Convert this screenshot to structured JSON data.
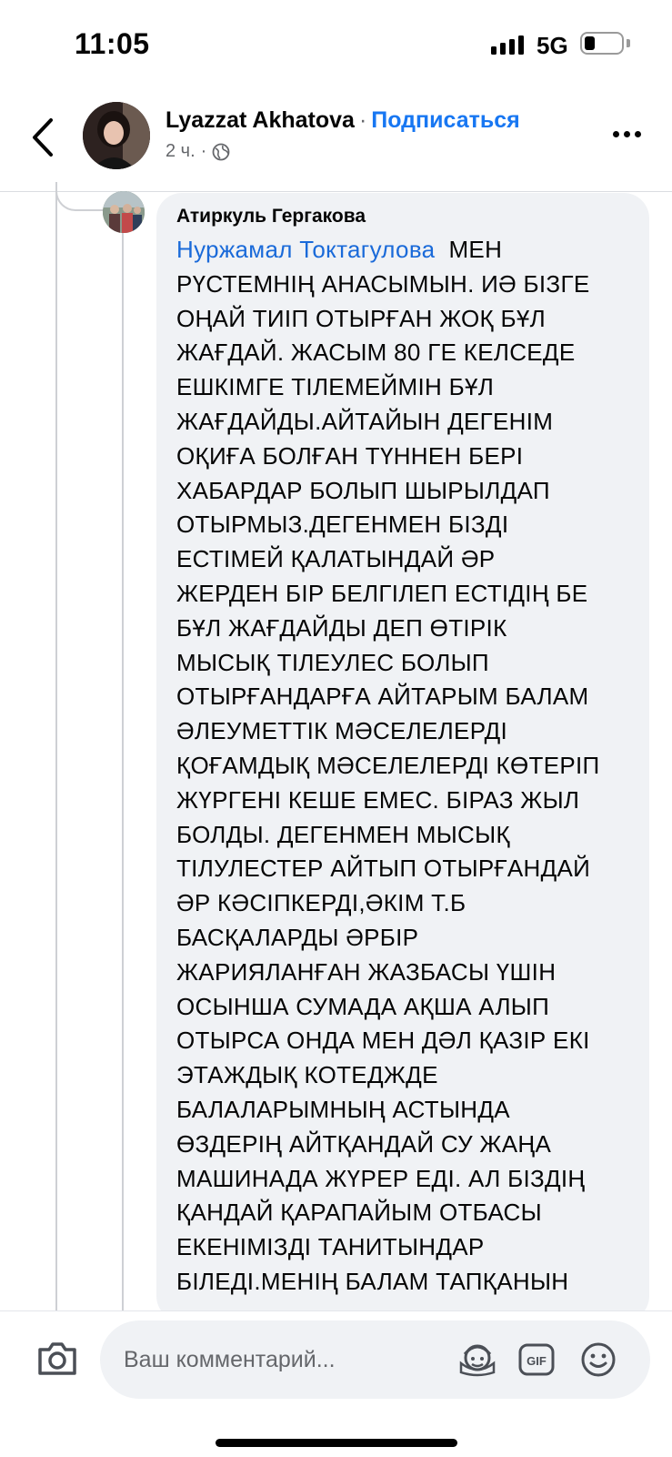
{
  "status_bar": {
    "time": "11:05",
    "network": "5G",
    "battery_level": 0.3
  },
  "header": {
    "author": "Lyazzat Akhatova",
    "separator": "·",
    "subscribe_label": "Подписаться",
    "time_ago": "2 ч.",
    "meta_separator": "·",
    "icons": {
      "back": "chevron-left-icon",
      "audience": "globe-icon",
      "more": "more-horizontal-icon"
    }
  },
  "comment": {
    "author": "Атиркуль Гергакова",
    "mention": "Нуржамал Токтагулова",
    "lines": [
      "МЕН",
      "РҮСТЕМНІҢ АНАСЫМЫН. ИӘ БІЗГЕ",
      "ОҢАЙ ТИІП ОТЫРҒАН ЖОҚ БҰЛ",
      "ЖАҒДАЙ. ЖАСЫМ 80 ГЕ КЕЛСЕДЕ",
      "ЕШКІМГЕ ТІЛЕМЕЙМІН БҰЛ",
      "ЖАҒДАЙДЫ.АЙТАЙЫН ДЕГЕНІМ",
      "ОҚИҒА БОЛҒАН ТҮННЕН БЕРІ",
      "ХАБАРДАР БОЛЫП ШЫРЫЛДАП",
      "ОТЫРМЫЗ.ДЕГЕНМЕН БІЗДІ",
      "ЕСТІМЕЙ ҚАЛАТЫНДАЙ ӘР",
      "ЖЕРДЕН БІР БЕЛГІЛЕП ЕСТІДІҢ БЕ",
      "БҰЛ ЖАҒДАЙДЫ ДЕП ӨТІРІК",
      "МЫСЫҚ ТІЛЕУЛЕС БОЛЫП",
      "ОТЫРҒАНДАРҒА АЙТАРЫМ БАЛАМ",
      "ӘЛЕУМЕТТІК МӘСЕЛЕЛЕРДІ",
      "ҚОҒАМДЫҚ МӘСЕЛЕЛЕРДІ КӨТЕРІП",
      "ЖҮРГЕНІ КЕШЕ ЕМЕС. БІРАЗ ЖЫЛ",
      "БОЛДЫ. ДЕГЕНМЕН МЫСЫҚ",
      "ТІЛУЛЕСТЕР АЙТЫП ОТЫРҒАНДАЙ",
      "ӘР КӘСІПКЕРДІ,ӘКІМ Т.Б",
      "БАСҚАЛАРДЫ ӘРБІР",
      "ЖАРИЯЛАНҒАН ЖАЗБАСЫ ҮШІН",
      "ОСЫНША СУМАДА АҚША АЛЫП",
      "ОТЫРСА ОНДА МЕН ДӘЛ ҚАЗІР ЕКІ",
      "ЭТАЖДЫҚ КОТЕДЖДЕ",
      "БАЛАЛАРЫМНЫҢ АСТЫНДА",
      "ӨЗДЕРІҢ АЙТҚАНДАЙ СУ ЖАҢА",
      "МАШИНАДА ЖҮРЕР ЕДІ. АЛ БІЗДІҢ",
      "ҚАНДАЙ ҚАРАПАЙЫМ ОТБАСЫ",
      "ЕКЕНІМІЗДІ ТАНИТЫНДАР",
      "БІЛЕДІ.МЕНІҢ БАЛАМ ТАПҚАНЫН"
    ]
  },
  "composer": {
    "placeholder": "Ваш комментарий...",
    "icons": {
      "camera": "camera-icon",
      "avatar": "avatar-sticker-icon",
      "gif": "gif-icon",
      "emoji": "emoji-icon"
    },
    "gif_label": "GIF"
  }
}
